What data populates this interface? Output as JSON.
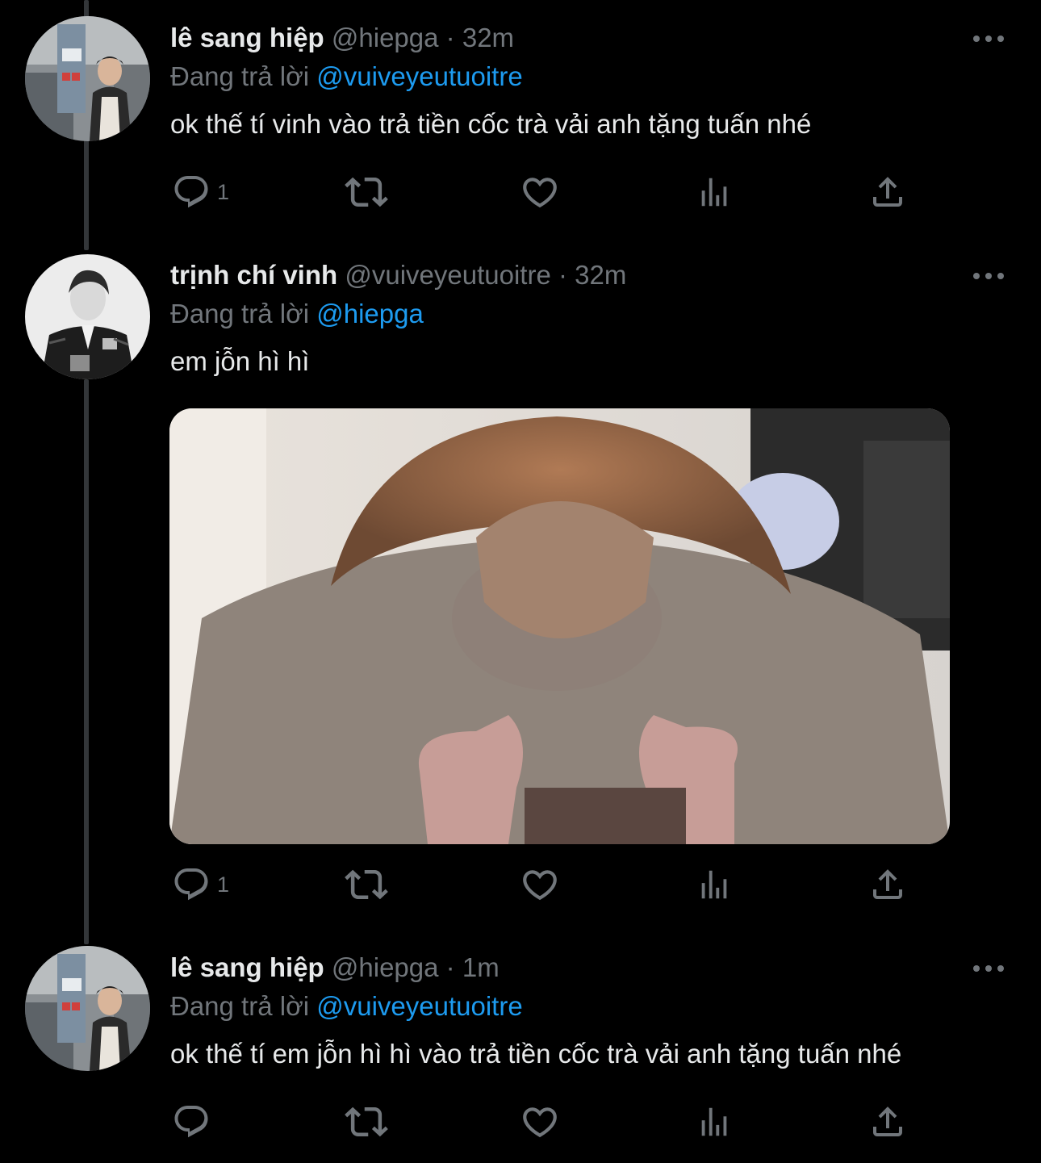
{
  "colors": {
    "background": "#000000",
    "text": "#e7e9ea",
    "muted": "#71767b",
    "accent": "#1d9bf0",
    "thread_line": "#333639"
  },
  "icons": {
    "reply": "reply-icon",
    "retweet": "retweet-icon",
    "like": "heart-icon",
    "views": "analytics-icon",
    "share": "share-icon",
    "more": "more-icon"
  },
  "tweets": [
    {
      "name": "lê sang hiệp",
      "handle": "@hiepga",
      "separator": "·",
      "time": "32m",
      "replying_label": "Đang trả lời",
      "replying_to": "@vuiveyeutuoitre",
      "text": "ok thế tí vinh vào trả tiền cốc trà vải anh tặng tuấn nhé",
      "reply_count": "1"
    },
    {
      "name": "trịnh chí vinh",
      "handle": "@vuiveyeutuoitre",
      "separator": "·",
      "time": "32m",
      "replying_label": "Đang trả lời",
      "replying_to": "@hiepga",
      "text": "em jỗn hì hì",
      "reply_count": "1"
    },
    {
      "name": "lê sang hiệp",
      "handle": "@hiepga",
      "separator": "·",
      "time": "1m",
      "replying_label": "Đang trả lời",
      "replying_to": "@vuiveyeutuoitre",
      "text": "ok thế tí em jỗn hì hì vào trả tiền cốc trà vải anh tặng tuấn nhé",
      "reply_count": ""
    }
  ]
}
